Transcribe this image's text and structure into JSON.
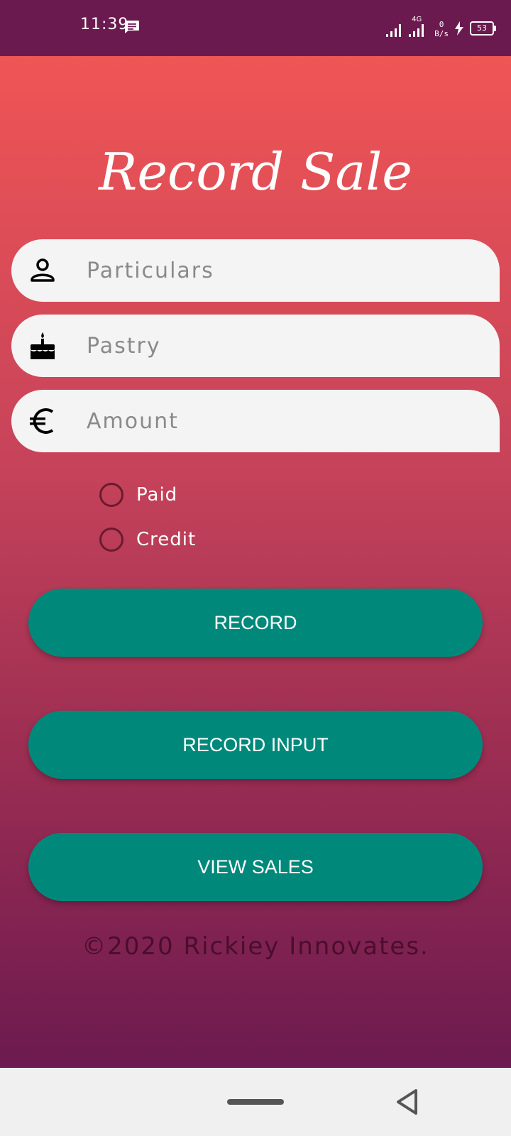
{
  "status_bar": {
    "time": "11:39",
    "network": "4G",
    "speed_value": "0",
    "speed_unit": "B/s",
    "battery": "53"
  },
  "page": {
    "title": "Record Sale"
  },
  "form": {
    "particulars_placeholder": "Particulars",
    "pastry_placeholder": "Pastry",
    "amount_placeholder": "Amount",
    "paid_label": "Paid",
    "credit_label": "Credit"
  },
  "buttons": {
    "record": "RECORD",
    "record_input": "RECORD INPUT",
    "view_sales": "VIEW SALES"
  },
  "footer": {
    "copyright": "©2020 Rickiey Innovates."
  },
  "icons": {
    "particulars": "person-icon",
    "pastry": "cake-icon",
    "amount": "euro-icon"
  },
  "colors": {
    "status_bar": "#6b1a4f",
    "gradient_top": "#ef5555",
    "gradient_bottom": "#6c1a50",
    "button": "#00897b",
    "field_bg": "#f4f4f4"
  }
}
